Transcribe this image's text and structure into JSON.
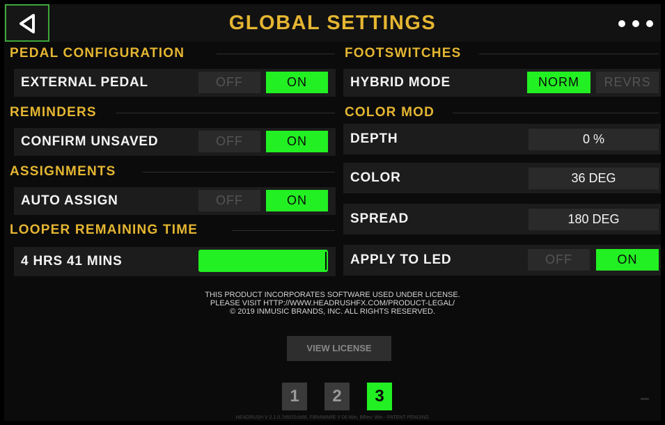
{
  "header": {
    "title": "GLOBAL SETTINGS",
    "back_icon": "back-triangle-icon",
    "more_icon": "more-dots-icon"
  },
  "colors": {
    "accent_yellow": "#e5b632",
    "active_green": "#22f022",
    "back_border": "#3ea83a",
    "inactive": "#2a2a2a"
  },
  "left": {
    "pedal_configuration": {
      "header": "PEDAL CONFIGURATION",
      "external_pedal": {
        "label": "EXTERNAL PEDAL",
        "off": "OFF",
        "on": "ON",
        "value": "ON"
      }
    },
    "reminders": {
      "header": "REMINDERS",
      "confirm_unsaved": {
        "label": "CONFIRM UNSAVED",
        "off": "OFF",
        "on": "ON",
        "value": "ON"
      }
    },
    "assignments": {
      "header": "ASSIGNMENTS",
      "auto_assign": {
        "label": "AUTO ASSIGN",
        "off": "OFF",
        "on": "ON",
        "value": "ON"
      }
    },
    "looper": {
      "header": "LOOPER REMAINING TIME",
      "time_label": "4 HRS 41 MINS",
      "remaining_fraction": 1.0
    }
  },
  "right": {
    "footswitches": {
      "header": "FOOTSWITCHES",
      "hybrid_mode": {
        "label": "HYBRID MODE",
        "norm": "NORM",
        "revrs": "REVRS",
        "value": "NORM"
      }
    },
    "color_mod": {
      "header": "COLOR MOD",
      "depth": {
        "label": "DEPTH",
        "value": "0 %"
      },
      "color": {
        "label": "COLOR",
        "value": "36 DEG"
      },
      "spread": {
        "label": "SPREAD",
        "value": "180 DEG"
      },
      "apply_to_led": {
        "label": "APPLY TO LED",
        "off": "OFF",
        "on": "ON",
        "value": "ON"
      }
    }
  },
  "legal": {
    "line1": "THIS PRODUCT INCORPORATES SOFTWARE USED UNDER LICENSE.",
    "line2": "PLEASE VISIT HTTP://WWW.HEADRUSHFX.COM/PRODUCT-LEGAL/",
    "line3": "© 2019 INMUSIC BRANDS, INC. ALL RIGHTS RESERVED."
  },
  "view_license": "VIEW LICENSE",
  "pages": [
    {
      "label": "1",
      "active": false
    },
    {
      "label": "2",
      "active": false
    },
    {
      "label": "3",
      "active": true
    }
  ],
  "footer": "HEADRUSH V 2.1.0.7d91f2cb98, FIRMWARE V 00.Win, BRev: Win - PATENT PENDING"
}
